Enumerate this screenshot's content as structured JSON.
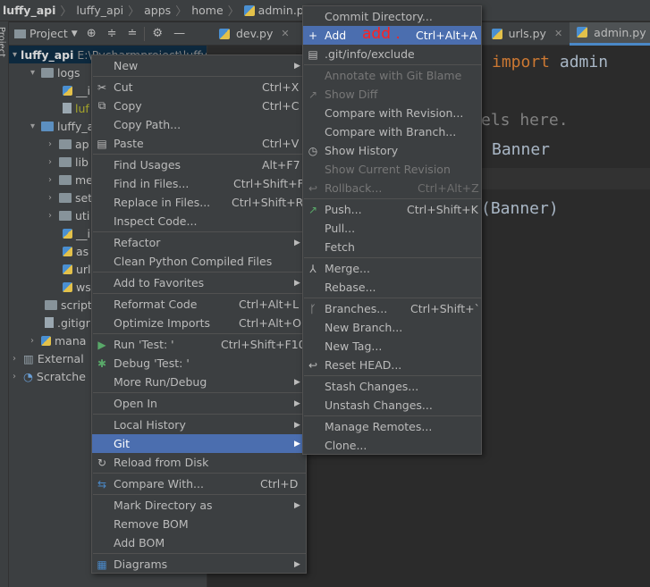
{
  "breadcrumb": [
    "luffy_api",
    "luffy_api",
    "apps",
    "home",
    "admin.py"
  ],
  "sidebar": {
    "stripe_label": "1: Project"
  },
  "toolbar": {
    "view_selector": "Project"
  },
  "tabs": [
    {
      "label": "dev.py"
    },
    {
      "label": "urls.py"
    },
    {
      "label": "admin.py",
      "active": true
    }
  ],
  "tree": [
    {
      "label": "luffy_api",
      "extra": "E:\\Pycharmproject\\luffy",
      "level": 0,
      "type": "folder-blue",
      "expanded": true
    },
    {
      "label": "logs",
      "level": 1,
      "type": "folder",
      "expanded": true
    },
    {
      "label": "__i",
      "level": 2,
      "type": "py"
    },
    {
      "label": "luf",
      "level": 2,
      "type": "txt"
    },
    {
      "label": "luffy_a",
      "level": 1,
      "type": "folder-blue",
      "expanded": true
    },
    {
      "label": "ap",
      "level": 2,
      "type": "folder",
      "expanded": false
    },
    {
      "label": "lib",
      "level": 2,
      "type": "folder",
      "expanded": false
    },
    {
      "label": "me",
      "level": 2,
      "type": "folder",
      "expanded": false
    },
    {
      "label": "set",
      "level": 2,
      "type": "folder",
      "expanded": false
    },
    {
      "label": "uti",
      "level": 2,
      "type": "folder",
      "expanded": false
    },
    {
      "label": "__i",
      "level": 2,
      "type": "py"
    },
    {
      "label": "as",
      "level": 2,
      "type": "py"
    },
    {
      "label": "url",
      "level": 2,
      "type": "py"
    },
    {
      "label": "ws",
      "level": 2,
      "type": "py"
    },
    {
      "label": "script",
      "level": 1,
      "type": "folder"
    },
    {
      "label": ".gitigr",
      "level": 1,
      "type": "txt"
    },
    {
      "label": "mana",
      "level": 1,
      "type": "py",
      "expanded": false
    },
    {
      "label": "External",
      "level": 0,
      "type": "lib",
      "expanded": false
    },
    {
      "label": "Scratche",
      "level": 0,
      "type": "scratch",
      "expanded": false
    }
  ],
  "editor": {
    "lines": [
      {
        "kw": "import",
        "text": " admin"
      },
      {
        "comment": "els here."
      },
      {
        "text": "Banner"
      },
      {
        "text": "(Banner)"
      }
    ]
  },
  "context_menu": [
    {
      "label": "New",
      "submenu": true
    },
    {
      "label": "Cut",
      "shortcut": "Ctrl+X",
      "icon": "cut-icon"
    },
    {
      "label": "Copy",
      "shortcut": "Ctrl+C",
      "icon": "copy-icon"
    },
    {
      "label": "Copy Path...",
      "shortcut": ""
    },
    {
      "label": "Paste",
      "shortcut": "Ctrl+V",
      "icon": "paste-icon"
    },
    {
      "label": "Find Usages",
      "shortcut": "Alt+F7"
    },
    {
      "label": "Find in Files...",
      "shortcut": "Ctrl+Shift+F"
    },
    {
      "label": "Replace in Files...",
      "shortcut": "Ctrl+Shift+R"
    },
    {
      "label": "Inspect Code..."
    },
    {
      "label": "Refactor",
      "submenu": true
    },
    {
      "label": "Clean Python Compiled Files"
    },
    {
      "label": "Add to Favorites",
      "submenu": true
    },
    {
      "label": "Reformat Code",
      "shortcut": "Ctrl+Alt+L"
    },
    {
      "label": "Optimize Imports",
      "shortcut": "Ctrl+Alt+O"
    },
    {
      "label": "Run 'Test: '",
      "shortcut": "Ctrl+Shift+F10",
      "icon": "run-icon"
    },
    {
      "label": "Debug 'Test: '",
      "icon": "debug-icon"
    },
    {
      "label": "More Run/Debug",
      "submenu": true
    },
    {
      "label": "Open In",
      "submenu": true
    },
    {
      "label": "Local History",
      "submenu": true
    },
    {
      "label": "Git",
      "submenu": true,
      "highlighted": true
    },
    {
      "label": "Reload from Disk",
      "icon": "reload-icon"
    },
    {
      "label": "Compare With...",
      "shortcut": "Ctrl+D",
      "icon": "compare-icon"
    },
    {
      "label": "Mark Directory as",
      "submenu": true
    },
    {
      "label": "Remove BOM"
    },
    {
      "label": "Add BOM"
    },
    {
      "label": "Diagrams",
      "submenu": true,
      "icon": "diagram-icon"
    }
  ],
  "git_menu": [
    {
      "label": "Commit Directory..."
    },
    {
      "label": "Add",
      "shortcut": "Ctrl+Alt+A",
      "highlighted": true,
      "icon": "plus-icon"
    },
    {
      "label": ".git/info/exclude",
      "icon": "git-file-icon"
    },
    {
      "label": "Annotate with Git Blame",
      "disabled": true
    },
    {
      "label": "Show Diff",
      "disabled": true,
      "icon": "diff-icon"
    },
    {
      "label": "Compare with Revision..."
    },
    {
      "label": "Compare with Branch..."
    },
    {
      "label": "Show History",
      "icon": "history-icon"
    },
    {
      "label": "Show Current Revision",
      "disabled": true
    },
    {
      "label": "Rollback...",
      "shortcut": "Ctrl+Alt+Z",
      "disabled": true,
      "icon": "rollback-icon"
    },
    {
      "label": "Push...",
      "shortcut": "Ctrl+Shift+K",
      "icon": "push-icon"
    },
    {
      "label": "Pull..."
    },
    {
      "label": "Fetch"
    },
    {
      "label": "Merge...",
      "icon": "merge-icon"
    },
    {
      "label": "Rebase..."
    },
    {
      "label": "Branches...",
      "shortcut": "Ctrl+Shift+`",
      "icon": "branch-icon"
    },
    {
      "label": "New Branch..."
    },
    {
      "label": "New Tag..."
    },
    {
      "label": "Reset HEAD...",
      "icon": "reset-icon"
    },
    {
      "label": "Stash Changes..."
    },
    {
      "label": "Unstash Changes..."
    },
    {
      "label": "Manage Remotes..."
    },
    {
      "label": "Clone..."
    }
  ],
  "annotation": "add ."
}
